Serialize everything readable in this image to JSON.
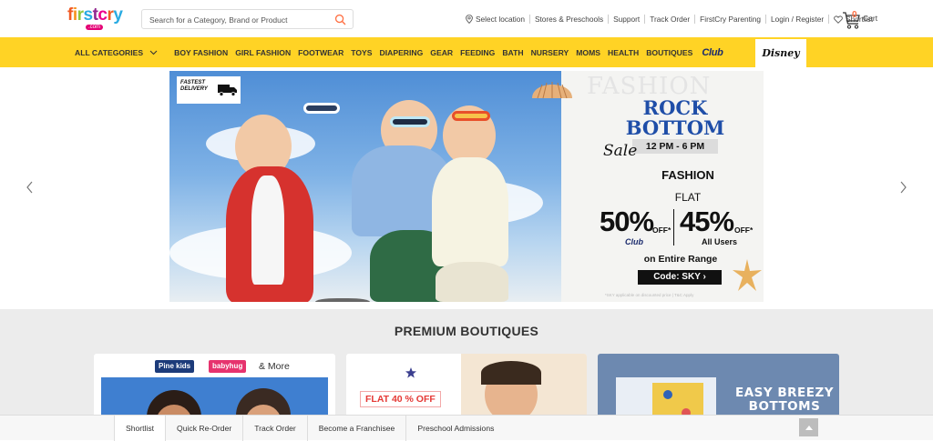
{
  "header": {
    "logo_word": "firstcry",
    "logo_suffix": ".com",
    "search_placeholder": "Search for a Category, Brand or Product",
    "links": [
      "Select location",
      "Stores & Preschools",
      "Support",
      "Track Order",
      "FirstCry Parenting",
      "Login / Register",
      "Shortlist"
    ],
    "cart_label": "Cart",
    "cart_count": "0",
    "logo_colors": [
      "#f15a24",
      "#f7941d",
      "#8dc63f",
      "#29abe2",
      "#92278f",
      "#ec008c",
      "#f15a24",
      "#29abe2"
    ]
  },
  "nav": {
    "items": [
      "ALL CATEGORIES",
      "BOY FASHION",
      "GIRL FASHION",
      "FOOTWEAR",
      "TOYS",
      "DIAPERING",
      "GEAR",
      "FEEDING",
      "BATH",
      "NURSERY",
      "MOMS",
      "HEALTH",
      "BOUTIQUES"
    ],
    "club_label": "Club",
    "disney_label": "Disney",
    "bg_color": "#ffd325"
  },
  "banner": {
    "delivery_badge": "FASTEST DELIVERY",
    "bg_word": "FASHION",
    "title_line1": "ROCK",
    "title_line2": "BOTTOM",
    "sale_word": "Sale",
    "time": "12 PM - 6 PM",
    "fashion": "FASHION",
    "flat": "FLAT",
    "club_pct": "50%",
    "club_off": "OFF*",
    "club_tag": "Club",
    "all_pct": "45%",
    "all_off": "OFF*",
    "all_users": "All Users",
    "range": "on Entire Range",
    "code": "Code: SKY ›",
    "fine_print": "*SKY applicable on discounted price | T&C Apply",
    "title_color": "#1f4ea8"
  },
  "boutiques": {
    "title": "PREMIUM BOUTIQUES",
    "card1": {
      "brand1": "Pine kids",
      "brand2": "babyhug",
      "more": "& More"
    },
    "card2": {
      "offer": "FLAT 40 % OFF"
    },
    "card3": {
      "headline1": "EASY BREEZY",
      "headline2": "BOTTOMS"
    }
  },
  "bottom_bar": {
    "tabs": [
      "Shortlist",
      "Quick Re-Order",
      "Track Order",
      "Become a Franchisee",
      "Preschool Admissions"
    ]
  }
}
